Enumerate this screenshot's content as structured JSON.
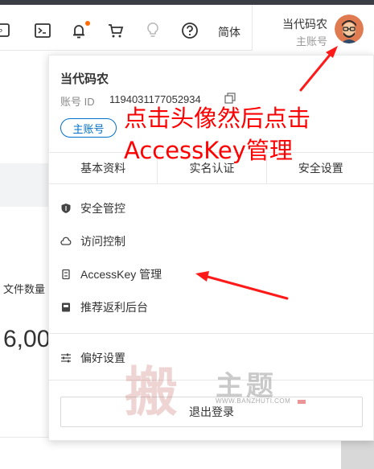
{
  "topbar": {
    "icons": [
      "app-icon",
      "terminal-icon",
      "bell-icon",
      "cart-icon",
      "lightbulb-icon",
      "help-icon"
    ],
    "language_label": "简体",
    "user_name": "当代码农",
    "user_role": "主账号"
  },
  "background": {
    "label": "文件数量",
    "value": "6,00"
  },
  "dropdown": {
    "name": "当代码农",
    "id_label": "账号 ID",
    "id_value": "1194031177052934",
    "role_badge": "主账号",
    "tabs": [
      {
        "label": "基本资料"
      },
      {
        "label": "实名认证"
      },
      {
        "label": "安全设置"
      }
    ],
    "menu": [
      {
        "label": "安全管控",
        "icon": "shield-icon"
      },
      {
        "label": "访问控制",
        "icon": "cloud-icon"
      },
      {
        "label": "AccessKey 管理",
        "icon": "key-icon"
      },
      {
        "label": "推荐返利后台",
        "icon": "badge-icon"
      },
      {
        "label": "偏好设置",
        "icon": "sliders-icon"
      }
    ],
    "logout": "退出登录"
  },
  "annotation": {
    "line1": "点击头像然后点击",
    "line2": "AccessKey管理"
  },
  "watermark": {
    "big": "搬",
    "small": "主题",
    "url": "WWW.BANZHUTI.COM"
  },
  "colors": {
    "accent": "#0070cc",
    "annotation": "#ff0000",
    "notification": "#ff6a00",
    "topstrip": "#3a3d44"
  }
}
